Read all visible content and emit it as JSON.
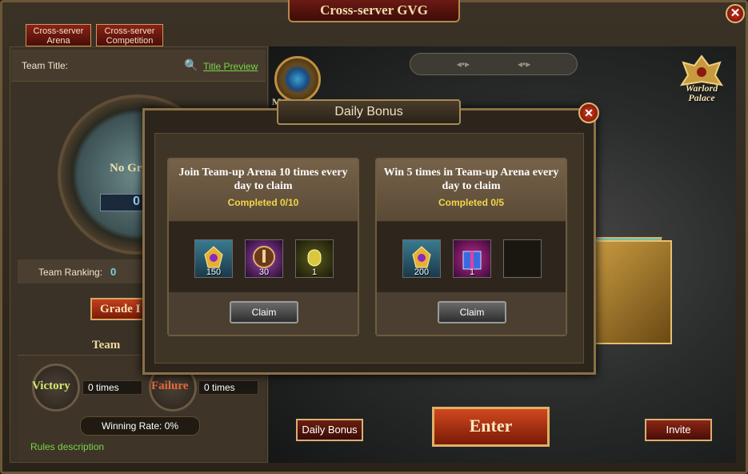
{
  "window": {
    "title": "Cross-server GVG",
    "close": "✕"
  },
  "tabs": [
    {
      "label": "Cross-server Arena"
    },
    {
      "label": "Cross-server Competition"
    }
  ],
  "left_panel": {
    "team_title_label": "Team Title:",
    "title_preview": "Title Preview",
    "no_group": "No Gr",
    "score": "0",
    "team_ranking_label": "Team Ranking:",
    "team_ranking_value": "0",
    "grade_button": "Grade I",
    "team_header": "Team",
    "victory_label": "Victory",
    "victory_times": "0 times",
    "failure_label": "Failure",
    "failure_times": "0 times",
    "winning_rate": "Winning Rate: 0%",
    "rules": "Rules description"
  },
  "right_panel": {
    "emblem_label": "M",
    "warlord_palace": "Warlord Palace",
    "daily_bonus_button": "Daily Bonus",
    "enter_button": "Enter",
    "invite_button": "Invite"
  },
  "dialog": {
    "title": "Daily Bonus",
    "close": "✕",
    "cards": [
      {
        "title": "Join Team-up Arena 10 times every day to claim",
        "status": "Completed 0/10",
        "items": [
          {
            "icon": "gold-badge-icon",
            "qty": "150"
          },
          {
            "icon": "tower-medal-icon",
            "qty": "30"
          },
          {
            "icon": "gold-pass-icon",
            "qty": "1"
          }
        ],
        "claim": "Claim"
      },
      {
        "title": "Win 5 times in Team-up Arena every day to claim",
        "status": "Completed 0/5",
        "items": [
          {
            "icon": "gold-badge-icon",
            "qty": "200"
          },
          {
            "icon": "gift-box-icon",
            "qty": "1"
          },
          {
            "icon": "empty-slot-icon",
            "qty": ""
          }
        ],
        "claim": "Claim"
      }
    ]
  },
  "colors": {
    "status_yellow": "#f0d64a",
    "link_green": "#7bd34a",
    "button_red": "#8a2616"
  }
}
